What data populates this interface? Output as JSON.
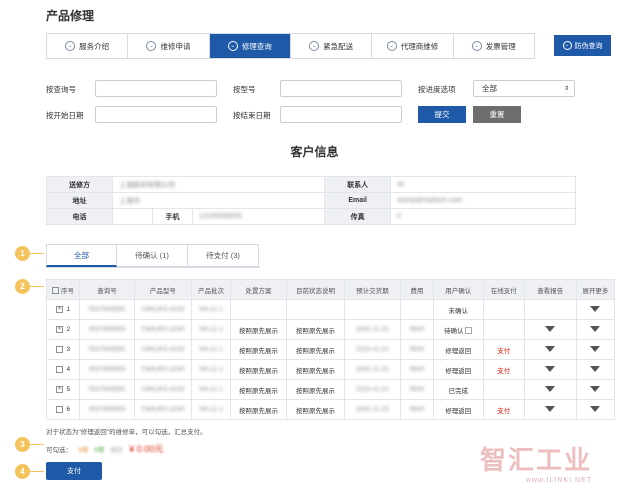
{
  "page": {
    "title": "产品修理"
  },
  "nav": {
    "tabs": [
      {
        "label": "服务介绍",
        "active": false
      },
      {
        "label": "维修申请",
        "active": false
      },
      {
        "label": "修理查询",
        "active": true
      },
      {
        "label": "紧急配送",
        "active": false
      },
      {
        "label": "代理商维修",
        "active": false
      },
      {
        "label": "发票管理",
        "active": false
      }
    ],
    "anti_fake_label": "防伪查询"
  },
  "search": {
    "query_no_label": "按查询号",
    "model_label": "按型号",
    "progress_label": "按进度选项",
    "progress_value": "全部",
    "start_date_label": "按开始日期",
    "end_date_label": "按结束日期",
    "submit_label": "提交",
    "reset_label": "重置"
  },
  "customer": {
    "section_title": "客户信息",
    "sender_label": "送修方",
    "sender_value": "上海超卓有限公司",
    "contact_label": "联系人",
    "contact_value": "wr",
    "address_label": "地址",
    "address_value": "上海市",
    "email_label": "Email",
    "email_value": "wanqi@matiech.com",
    "phone_label": "电话",
    "mobile_label": "手机",
    "mobile_value": "13195506055",
    "fax_label": "传真",
    "fax_value": "0"
  },
  "markers": [
    "1",
    "2",
    "3",
    "4"
  ],
  "status_tabs": [
    {
      "label": "全部",
      "active": true
    },
    {
      "label": "待确认 (1)",
      "active": false
    },
    {
      "label": "待支付 (3)",
      "active": false
    }
  ],
  "orders": {
    "headers": [
      "序号",
      "查询号",
      "产品型号",
      "产品批次",
      "处置方案",
      "目前状态说明",
      "预计交货期",
      "费用",
      "用户确认",
      "在线支付",
      "查看报告",
      "展开更多"
    ],
    "rows": [
      {
        "no": "1",
        "query": "5027909555",
        "model": "CMSJKS-3230",
        "batch": "SN-11-1",
        "plan": "",
        "status": "",
        "eta": "",
        "fee": "",
        "confirm": "未确认",
        "pay": "",
        "report": false,
        "checkbox": "x"
      },
      {
        "no": "2",
        "query": "5027909555",
        "model": "CMSJKS-3230",
        "batch": "SN-11-1",
        "plan": "按照原先展示",
        "status": "按照原先展示",
        "eta": "2020-11-22",
        "fee": "9500",
        "confirm": "待确认",
        "pay": "",
        "report": true,
        "checkbox": "x"
      },
      {
        "no": "3",
        "query": "5027909555",
        "model": "CMSJKS-3230",
        "batch": "SN-11-1",
        "plan": "按照原先展示",
        "status": "按照原先展示",
        "eta": "2020-11-22",
        "fee": "9500",
        "confirm": "修理返回",
        "pay": "支付",
        "report": true,
        "checkbox": ""
      },
      {
        "no": "4",
        "query": "5027909555",
        "model": "CMSJKS-3230",
        "batch": "SN-11-1",
        "plan": "按照原先展示",
        "status": "按照原先展示",
        "eta": "2020-11-22",
        "fee": "9500",
        "confirm": "修理返回",
        "pay": "支付",
        "report": true,
        "checkbox": ""
      },
      {
        "no": "5",
        "query": "5027909555",
        "model": "CMSJKS-3230",
        "batch": "SN-11-1",
        "plan": "按照原先展示",
        "status": "按照原先展示",
        "eta": "2020-11-22",
        "fee": "9500",
        "confirm": "已完成",
        "pay": "",
        "report": true,
        "checkbox": "x"
      },
      {
        "no": "6",
        "query": "5027909555",
        "model": "CMSJKS-3230",
        "batch": "SN-11-1",
        "plan": "按照原先展示",
        "status": "按照原先展示",
        "eta": "2020-11-23",
        "fee": "9500",
        "confirm": "修理返回",
        "pay": "支付",
        "report": true,
        "checkbox": ""
      }
    ]
  },
  "footer": {
    "note": "对于状态为\"修理返回\"的维修单，可以勾选，汇总支付。",
    "selectable_label": "可勾选：",
    "selectable_count": "3项",
    "selected_count": "0项",
    "total_label": "合计",
    "total_value": "¥ 0.00元",
    "pay_label": "支付"
  },
  "watermark": {
    "main": "智汇工业",
    "sub": "www.ILINKI.NET"
  },
  "colors": {
    "primary": "#1e5aa8",
    "marker": "#f3c45c",
    "pay": "#d81e06"
  }
}
